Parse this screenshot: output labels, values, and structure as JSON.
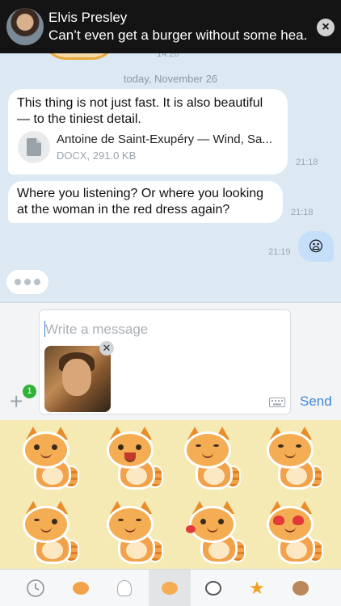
{
  "notification": {
    "sender": "Elvis Presley",
    "preview": "Can’t even get a burger without some hea..."
  },
  "chat": {
    "partial_time": "14:20",
    "date_separator": "today, November 26",
    "messages": [
      {
        "text": "This thing is not just fast. It is also beautiful — to the tiniest detail.",
        "file_name": "Antoine de Saint-Exupéry — Wind, Sa...",
        "file_meta": "DOCX, 291.0 KB",
        "time": "21:18"
      },
      {
        "text": "Where you listening? Or where you looking at the woman in the red dress again?",
        "time": "21:18"
      },
      {
        "emoji": "😦",
        "time": "21:19"
      }
    ]
  },
  "composer": {
    "placeholder": "Write a message",
    "attach_badge": "1",
    "send_label": "Send",
    "remove_symbol": "✕"
  },
  "sticker_tabs": [
    "recent-icon",
    "cat-pack-1-icon",
    "ghost-pack-icon",
    "cat-pack-2-icon",
    "dog-pack-icon",
    "star-pack-icon",
    "monkey-pack-icon"
  ],
  "colors": {
    "accent": "#3d89d6",
    "chat_bg": "#dce8f2",
    "outgoing_bubble": "#c5defa",
    "sticker_bg": "#f6eab4",
    "badge": "#2fb236"
  }
}
